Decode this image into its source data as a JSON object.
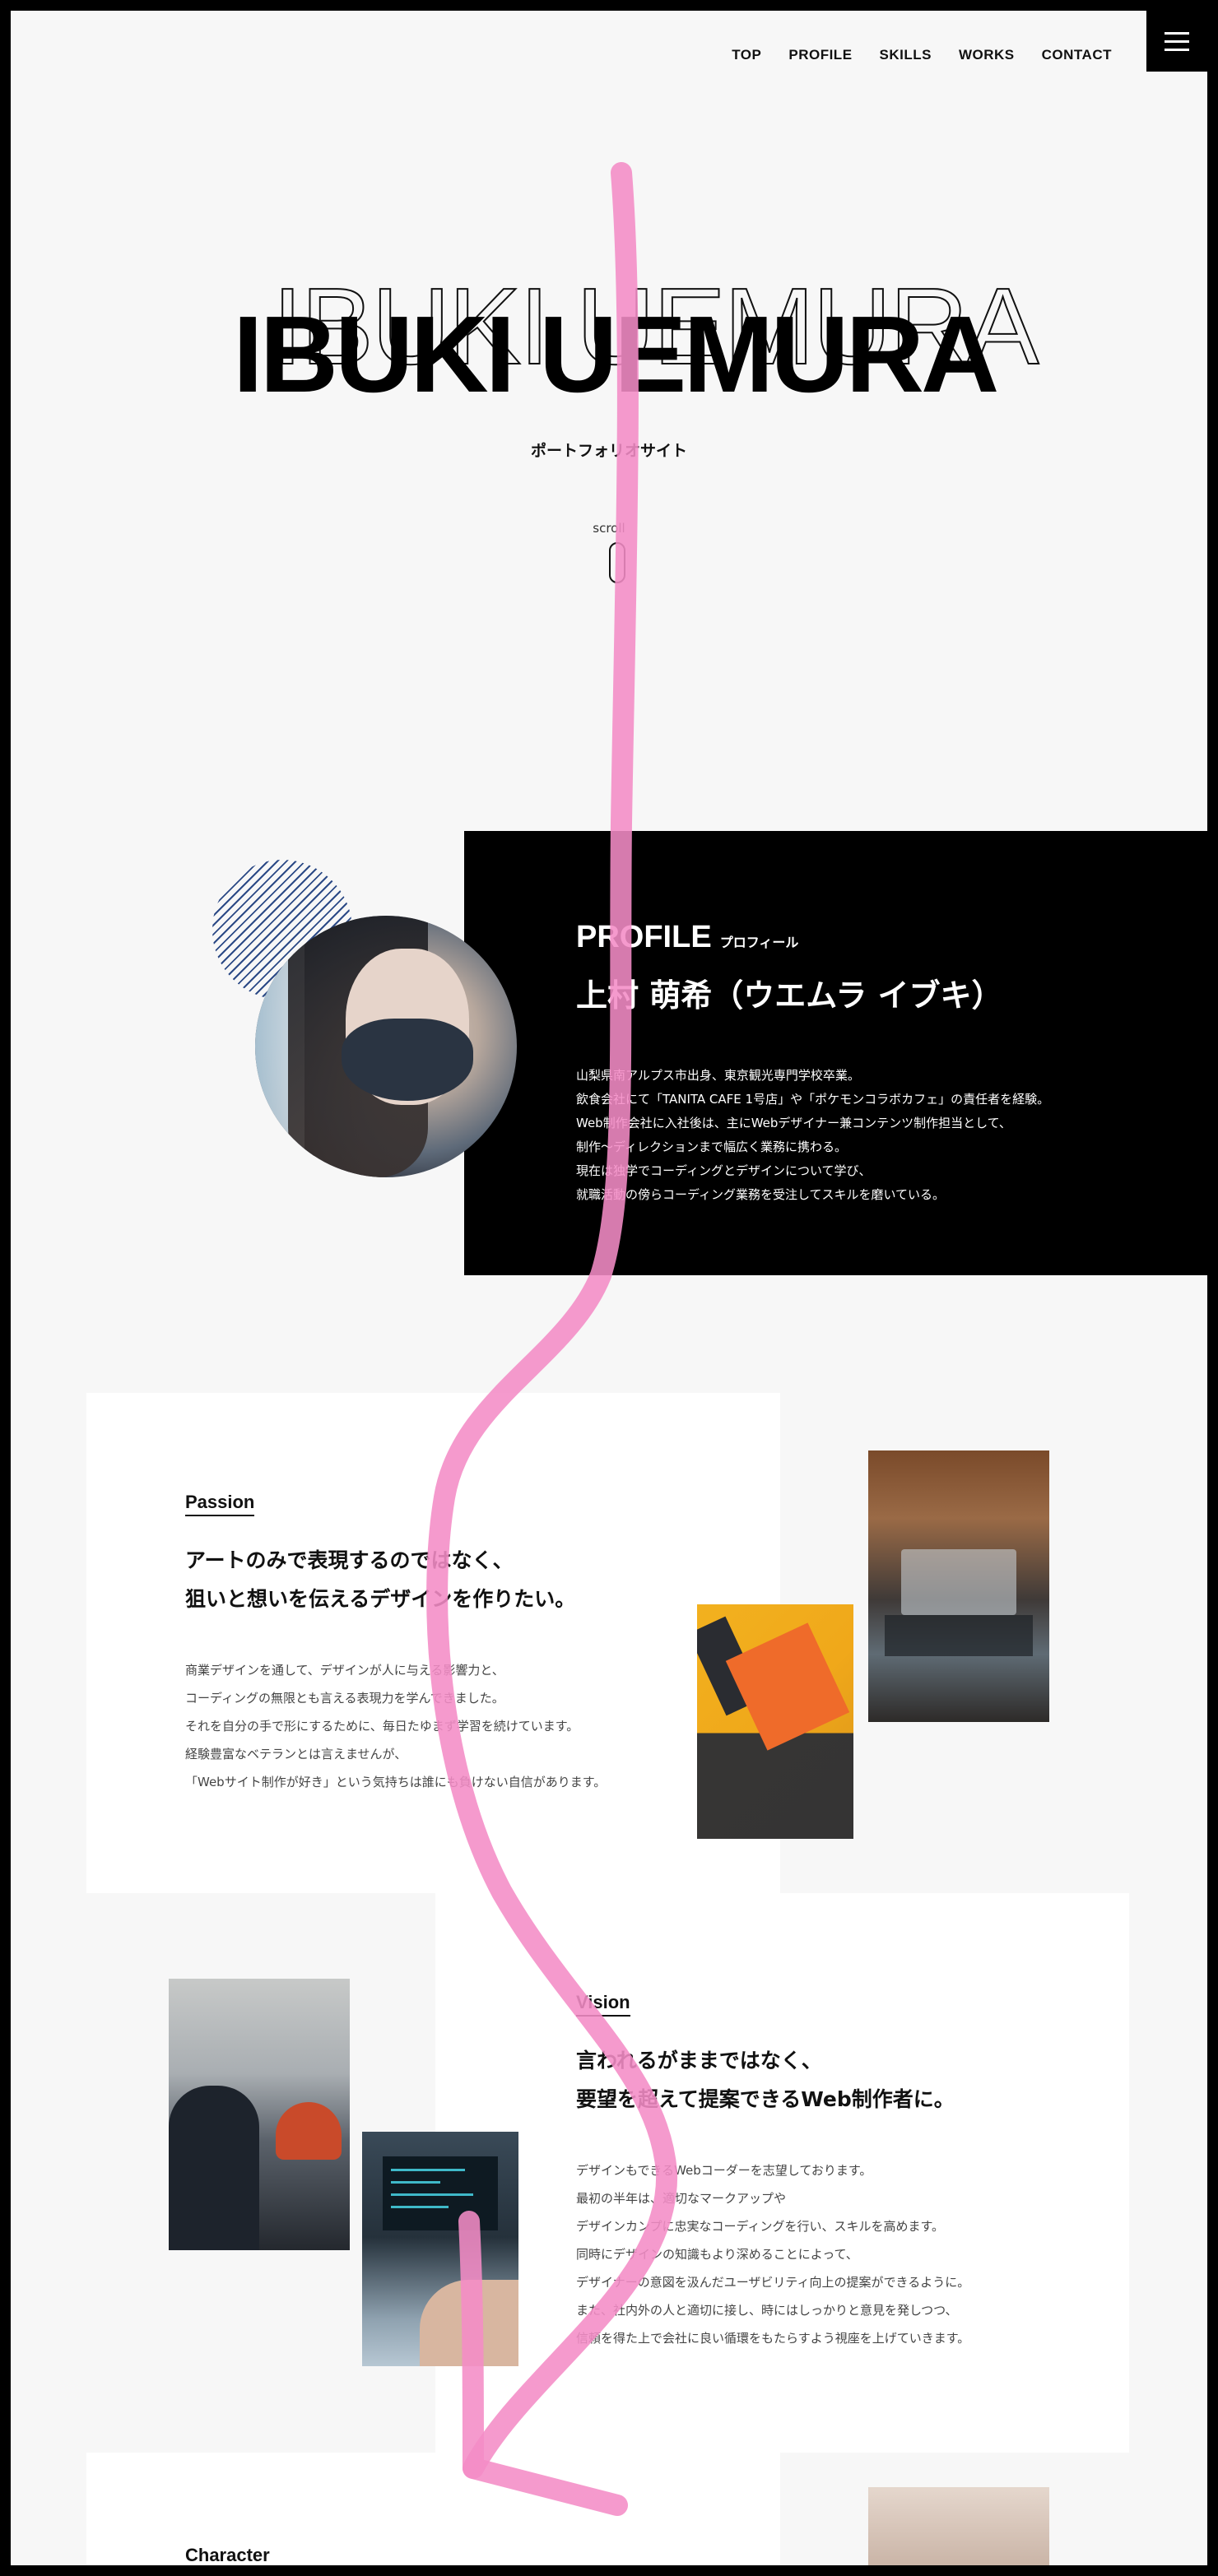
{
  "nav": {
    "items": [
      "TOP",
      "PROFILE",
      "SKILLS",
      "WORKS",
      "CONTACT"
    ]
  },
  "hero": {
    "title": "IBUKI UEMURA",
    "subtitle": "ポートフォリオサイト",
    "scroll_label": "scroll"
  },
  "profile": {
    "title": "PROFILE",
    "title_ja": "プロフィール",
    "name": "上村 萌希（ウエムラ イブキ）",
    "lines": [
      "山梨県南アルプス市出身、東京観光専門学校卒業。",
      "飲食会社にて「TANITA CAFE 1号店」や「ポケモンコラボカフェ」の責任者を経験。",
      "Web制作会社に入社後は、主にWebデザイナー兼コンテンツ制作担当として、",
      "制作〜ディレクションまで幅広く業務に携わる。",
      "現在は独学でコーディングとデザインについて学び、",
      "就職活動の傍らコーディング業務を受注してスキルを磨いている。"
    ]
  },
  "passion": {
    "label": "Passion",
    "head": [
      "アートのみで表現するのではなく、",
      "狙いと想いを伝えるデザインを作りたい。"
    ],
    "body": [
      "商業デザインを通して、デザインが人に与える影響力と、",
      "コーディングの無限とも言える表現力を学んできました。",
      "それを自分の手で形にするために、毎日たゆまず学習を続けています。",
      "経験豊富なベテランとは言えませんが、",
      "「Webサイト制作が好き」という気持ちは誰にも負けない自信があります。"
    ]
  },
  "vision": {
    "label": "Vision",
    "head": [
      "言われるがままではなく、",
      "要望を超えて提案できるWeb制作者に。"
    ],
    "body": [
      "デザインもできるWebコーダーを志望しております。",
      "最初の半年は、適切なマークアップや",
      "デザインカンプに忠実なコーディングを行い、スキルを高めます。",
      "同時にデザインの知識もより深めることによって、",
      "デザイナーの意図を汲んだユーザビリティ向上の提案ができるように。",
      "また、社内外の人と適切に接し、時にはしっかりと意見を発しつつ、",
      "信頼を得た上で会社に良い循環をもたらすよう視座を上げていきます。"
    ]
  },
  "next_section": {
    "label": "Character"
  },
  "colors": {
    "accent_annotation": "#f48cc6",
    "panel": "#000000",
    "background": "#f7f7f7"
  },
  "icons": [
    "hamburger-menu-icon",
    "scroll-mouse-icon"
  ]
}
